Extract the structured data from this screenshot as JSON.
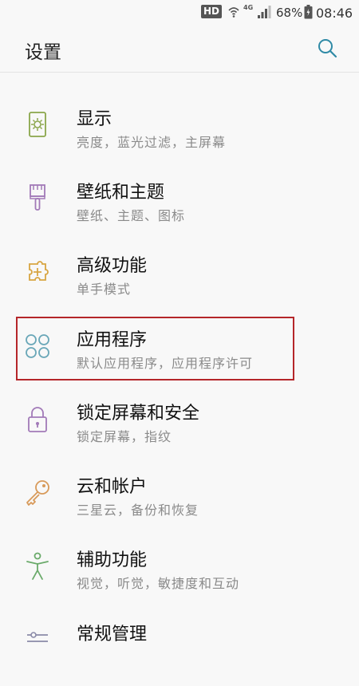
{
  "status_bar": {
    "hd": "HD",
    "network": "4G",
    "battery_text": "68%",
    "time": "08:46"
  },
  "header": {
    "title": "设置"
  },
  "items": [
    {
      "label": "显示",
      "sub": "亮度，蓝光过滤，主屏幕",
      "icon": "display-icon",
      "color": "#8aa64a"
    },
    {
      "label": "壁纸和主题",
      "sub": "壁纸、主题、图标",
      "icon": "brush-icon",
      "color": "#a27ab8"
    },
    {
      "label": "高级功能",
      "sub": "单手模式",
      "icon": "puzzle-plus-icon",
      "color": "#d8a542"
    },
    {
      "label": "应用程序",
      "sub": "默认应用程序，应用程序许可",
      "icon": "apps-grid-icon",
      "color": "#6aa7b8"
    },
    {
      "label": "锁定屏幕和安全",
      "sub": "锁定屏幕，指纹",
      "icon": "lock-icon",
      "color": "#a27ab8"
    },
    {
      "label": "云和帐户",
      "sub": "三星云，备份和恢复",
      "icon": "key-icon",
      "color": "#d89a5a"
    },
    {
      "label": "辅助功能",
      "sub": "视觉，听觉，敏捷度和互动",
      "icon": "accessibility-icon",
      "color": "#6aaa6a"
    },
    {
      "label": "常规管理",
      "sub": "",
      "icon": "general-management-icon",
      "color": "#8a8aa8"
    }
  ],
  "colors": {
    "highlight": "#b5262a",
    "accent": "#2f8aa6"
  }
}
